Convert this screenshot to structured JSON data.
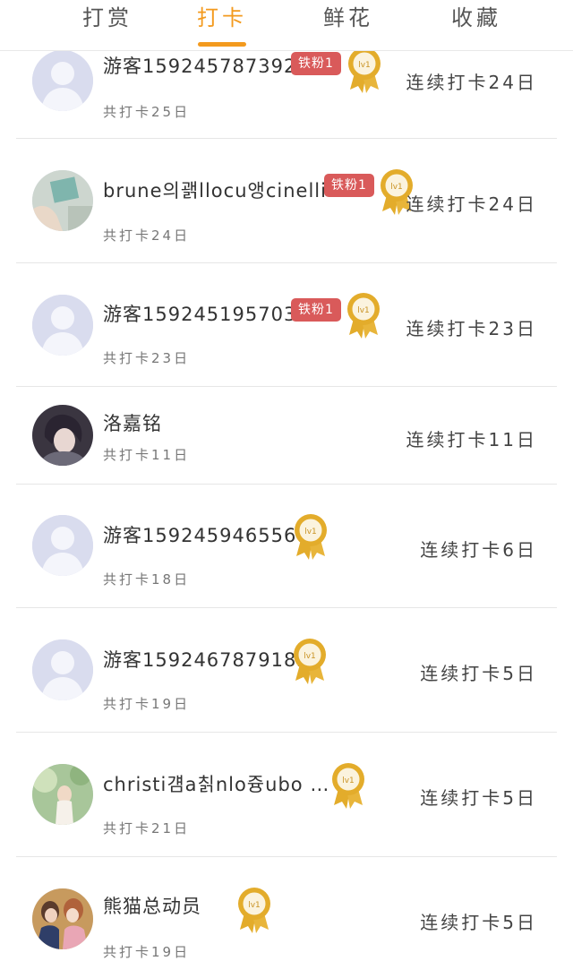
{
  "tabs": [
    {
      "label": "打赏"
    },
    {
      "label": "打卡"
    },
    {
      "label": "鲜花"
    },
    {
      "label": "收藏"
    }
  ],
  "colors": {
    "accent": "#f39a1e",
    "fan_badge": "#d95a5a",
    "medal_gold": "#e3ac2b"
  },
  "rows": [
    {
      "name": "游客1592457873920",
      "fan_badge": "铁粉1",
      "medal": "gold-medal-icon",
      "total": "共打卡25日",
      "streak": "连续打卡24日",
      "avatar": "default-avatar-icon"
    },
    {
      "name": "brune의괡llocu앵cinelli",
      "fan_badge": "铁粉1",
      "medal": "gold-medal-icon",
      "total": "共打卡24日",
      "streak": "连续打卡24日",
      "avatar": "photo-avatar"
    },
    {
      "name": "游客1592451957035",
      "fan_badge": "铁粉1",
      "medal": "gold-medal-icon",
      "total": "共打卡23日",
      "streak": "连续打卡23日",
      "avatar": "default-avatar-icon"
    },
    {
      "name": "洛嘉铭",
      "fan_badge": "",
      "medal": "",
      "total": "共打卡11日",
      "streak": "连续打卡11日",
      "avatar": "photo-avatar"
    },
    {
      "name": "游客1592459465568",
      "fan_badge": "",
      "medal": "gold-medal-icon",
      "total": "共打卡18日",
      "streak": "连续打卡6日",
      "avatar": "default-avatar-icon"
    },
    {
      "name": "游客1592467879182",
      "fan_badge": "",
      "medal": "gold-medal-icon",
      "total": "共打卡19日",
      "streak": "连续打卡5日",
      "avatar": "default-avatar-icon"
    },
    {
      "name": "christi걤a칡nlo즁ubo …",
      "fan_badge": "",
      "medal": "gold-medal-icon",
      "total": "共打卡21日",
      "streak": "连续打卡5日",
      "avatar": "photo-avatar"
    },
    {
      "name": "熊猫总动员",
      "fan_badge": "",
      "medal": "gold-medal-icon",
      "total": "共打卡19日",
      "streak": "连续打卡5日",
      "avatar": "photo-avatar"
    }
  ]
}
